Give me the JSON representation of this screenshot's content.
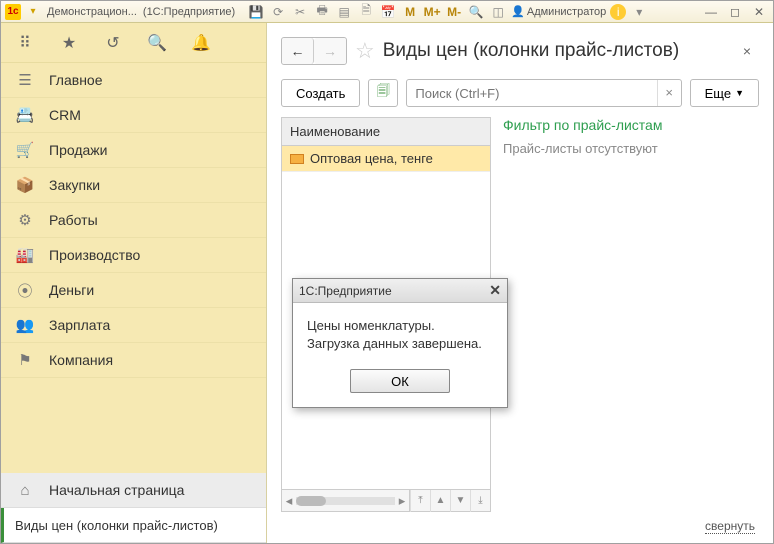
{
  "titlebar": {
    "app_badge": "1c",
    "title_left": "Демонстрацион...",
    "title_right": "(1С:Предприятие)",
    "user_label": "Администратор",
    "m_labels": [
      "M",
      "M+",
      "M-"
    ]
  },
  "sidebar": {
    "items": [
      {
        "icon": "menu-icon",
        "label": "Главное"
      },
      {
        "icon": "crm-icon",
        "label": "CRM"
      },
      {
        "icon": "sales-icon",
        "label": "Продажи"
      },
      {
        "icon": "purchases-icon",
        "label": "Закупки"
      },
      {
        "icon": "works-icon",
        "label": "Работы"
      },
      {
        "icon": "production-icon",
        "label": "Производство"
      },
      {
        "icon": "money-icon",
        "label": "Деньги"
      },
      {
        "icon": "salary-icon",
        "label": "Зарплата"
      },
      {
        "icon": "company-icon",
        "label": "Компания"
      }
    ],
    "bottom": [
      {
        "icon": "home-icon",
        "label": "Начальная страница"
      },
      {
        "icon": "",
        "label": "Виды цен (колонки прайс-листов)"
      }
    ]
  },
  "page": {
    "title": "Виды цен (колонки прайс-листов)",
    "toolbar": {
      "create_label": "Создать",
      "search_placeholder": "Поиск (Ctrl+F)",
      "more_label": "Еще"
    },
    "list": {
      "header": "Наименование",
      "rows": [
        {
          "label": "Оптовая цена, тенге",
          "selected": true
        },
        {
          "label": "",
          "selected": false
        }
      ]
    },
    "filter": {
      "title": "Фильтр по прайс-листам",
      "empty_text": "Прайс-листы отсутствуют"
    },
    "footer_link": "свернуть"
  },
  "modal": {
    "title": "1С:Предприятие",
    "line1": "Цены номенклатуры.",
    "line2": "Загрузка данных завершена.",
    "ok_label": "ОК"
  }
}
